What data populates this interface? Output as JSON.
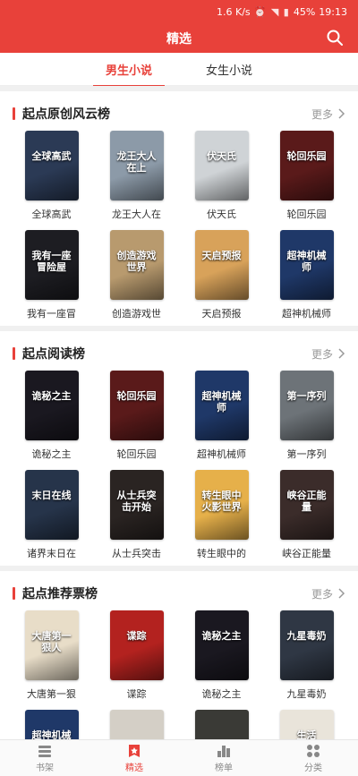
{
  "status": {
    "speed": "1.6 K/s",
    "battery": "45%",
    "time": "19:13"
  },
  "header": {
    "title": "精选"
  },
  "tabs": [
    {
      "label": "男生小说"
    },
    {
      "label": "女生小说"
    }
  ],
  "more_label": "更多",
  "sections": [
    {
      "title": "起点原创风云榜",
      "books": [
        {
          "name": "全球高武",
          "cover_text": "全球高武",
          "color": "#2b3a55"
        },
        {
          "name": "龙王大人在",
          "cover_text": "龙王大人在上",
          "color": "#8c9aa8"
        },
        {
          "name": "伏天氏",
          "cover_text": "伏天氏",
          "color": "#cfd3d6"
        },
        {
          "name": "轮回乐园",
          "cover_text": "轮回乐园",
          "color": "#5a1a1a"
        },
        {
          "name": "我有一座冒",
          "cover_text": "我有一座冒险屋",
          "color": "#1d1d22"
        },
        {
          "name": "创造游戏世",
          "cover_text": "创造游戏世界",
          "color": "#b89a6e"
        },
        {
          "name": "天启预报",
          "cover_text": "天启预报",
          "color": "#d8a25a"
        },
        {
          "name": "超神机械师",
          "cover_text": "超神机械师",
          "color": "#1f3868"
        }
      ]
    },
    {
      "title": "起点阅读榜",
      "books": [
        {
          "name": "诡秘之主",
          "cover_text": "诡秘之主",
          "color": "#1a1820"
        },
        {
          "name": "轮回乐园",
          "cover_text": "轮回乐园",
          "color": "#5a1a1a"
        },
        {
          "name": "超神机械师",
          "cover_text": "超神机械师",
          "color": "#1f3868"
        },
        {
          "name": "第一序列",
          "cover_text": "第一序列",
          "color": "#6d7378"
        },
        {
          "name": "诸界末日在",
          "cover_text": "末日在线",
          "color": "#26344a"
        },
        {
          "name": "从士兵突击",
          "cover_text": "从士兵突击开始",
          "color": "#2a2422"
        },
        {
          "name": "转生眼中的",
          "cover_text": "转生眼中火影世界",
          "color": "#e6b04a"
        },
        {
          "name": "峡谷正能量",
          "cover_text": "峡谷正能量",
          "color": "#3b2c2a"
        }
      ]
    },
    {
      "title": "起点推荐票榜",
      "books": [
        {
          "name": "大唐第一狠",
          "cover_text": "大唐第一狠人",
          "color": "#e8ddc8"
        },
        {
          "name": "谍踪",
          "cover_text": "谍踪",
          "color": "#b3221f"
        },
        {
          "name": "诡秘之主",
          "cover_text": "诡秘之主",
          "color": "#1a1820"
        },
        {
          "name": "九星毒奶",
          "cover_text": "九星毒奶",
          "color": "#2f3744"
        },
        {
          "name": "",
          "cover_text": "超神机械师",
          "color": "#1f3868"
        },
        {
          "name": "",
          "cover_text": "",
          "color": "#d4cfc6"
        },
        {
          "name": "",
          "cover_text": "",
          "color": "#3a3a36"
        },
        {
          "name": "",
          "cover_text": "生活",
          "color": "#e9e4da"
        }
      ]
    }
  ],
  "bottom_nav": [
    {
      "label": "书架",
      "icon": "bookshelf-icon"
    },
    {
      "label": "精选",
      "icon": "featured-icon"
    },
    {
      "label": "榜单",
      "icon": "ranking-icon"
    },
    {
      "label": "分类",
      "icon": "category-icon"
    }
  ],
  "colors": {
    "accent": "#e8413a"
  }
}
